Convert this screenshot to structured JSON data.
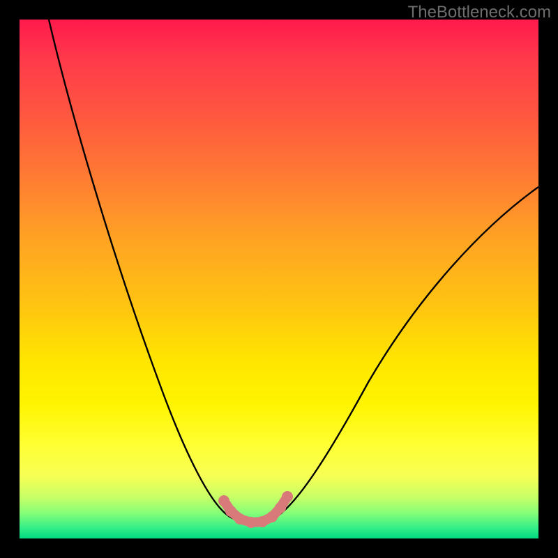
{
  "watermark": "TheBottleneck.com",
  "colors": {
    "frame": "#000000",
    "curve": "#000000",
    "marker": "#d97a7a",
    "gradient_top": "#ff1a4d",
    "gradient_bottom": "#00d980"
  },
  "chart_data": {
    "type": "line",
    "title": "",
    "xlabel": "",
    "ylabel": "",
    "xlim": [
      0,
      100
    ],
    "ylim": [
      0,
      100
    ],
    "series": [
      {
        "name": "bottleneck-curve",
        "x": [
          5,
          10,
          15,
          20,
          25,
          30,
          35,
          38,
          40,
          42,
          45,
          47,
          50,
          55,
          60,
          65,
          70,
          75,
          80,
          85,
          90,
          95,
          100
        ],
        "y": [
          100,
          88,
          74,
          60,
          46,
          33,
          20,
          12,
          7,
          4,
          2,
          2,
          4,
          10,
          17,
          24,
          31,
          38,
          45,
          51,
          57,
          62,
          67
        ]
      }
    ],
    "optimal_range": {
      "x_start": 40,
      "x_end": 48
    },
    "markers": {
      "name": "optimal-zone",
      "color": "#d97a7a",
      "points_x": [
        40,
        41,
        42,
        43,
        44,
        45,
        46,
        47,
        48
      ],
      "points_y": [
        7,
        5,
        4,
        3,
        2,
        2,
        2.5,
        3,
        4.5
      ]
    }
  }
}
